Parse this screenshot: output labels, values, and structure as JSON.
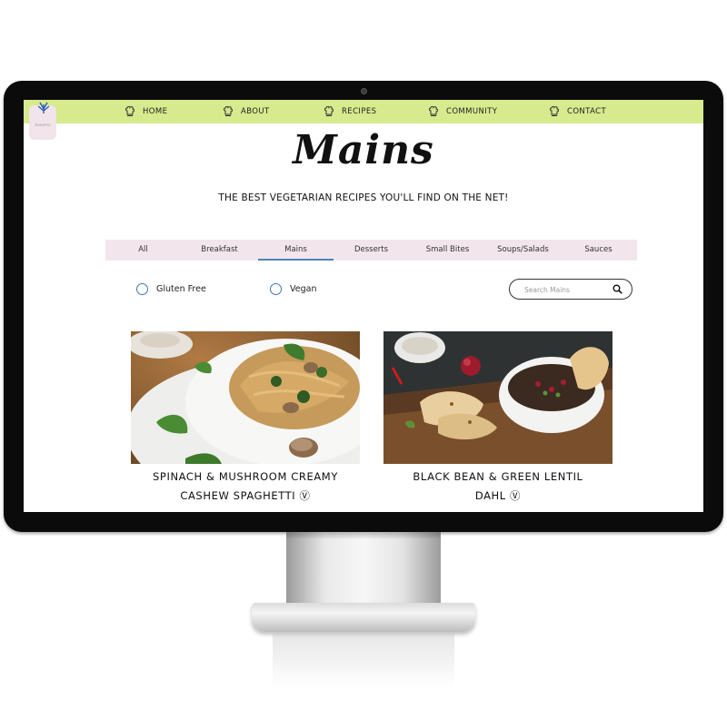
{
  "nav": {
    "items": [
      {
        "label": "HOME",
        "icon": "chef-hat-icon"
      },
      {
        "label": "ABOUT",
        "icon": "chef-hat-icon"
      },
      {
        "label": "RECIPES",
        "icon": "chef-hat-icon"
      },
      {
        "label": "COMMUNITY",
        "icon": "chef-hat-icon"
      },
      {
        "label": "CONTACT",
        "icon": "chef-hat-icon"
      }
    ]
  },
  "logo": {
    "text": "PINEAPPLE"
  },
  "page": {
    "title": "Mains",
    "tagline": "THE BEST VEGETARIAN RECIPES YOU'LL FIND ON THE NET!"
  },
  "tabs": [
    {
      "label": "All"
    },
    {
      "label": "Breakfast"
    },
    {
      "label": "Mains",
      "active": true
    },
    {
      "label": "Desserts"
    },
    {
      "label": "Small Bites"
    },
    {
      "label": "Soups/Salads"
    },
    {
      "label": "Sauces"
    }
  ],
  "filters": [
    {
      "label": "Gluten Free",
      "checked": false
    },
    {
      "label": "Vegan",
      "checked": false
    }
  ],
  "search": {
    "placeholder": "Search Mains",
    "value": ""
  },
  "recipes": [
    {
      "line1": "SPINACH & MUSHROOM CREAMY",
      "line2": "CASHEW SPAGHETTI Ⓥ",
      "image": "pasta-dish-photo"
    },
    {
      "line1": "BLACK BEAN & GREEN LENTIL",
      "line2": "DAHL Ⓥ",
      "image": "dahl-bowl-photo"
    }
  ],
  "colors": {
    "nav_bg": "#d7ea8e",
    "tabs_bg": "#f2e6ec",
    "accent": "#4e84b8"
  }
}
